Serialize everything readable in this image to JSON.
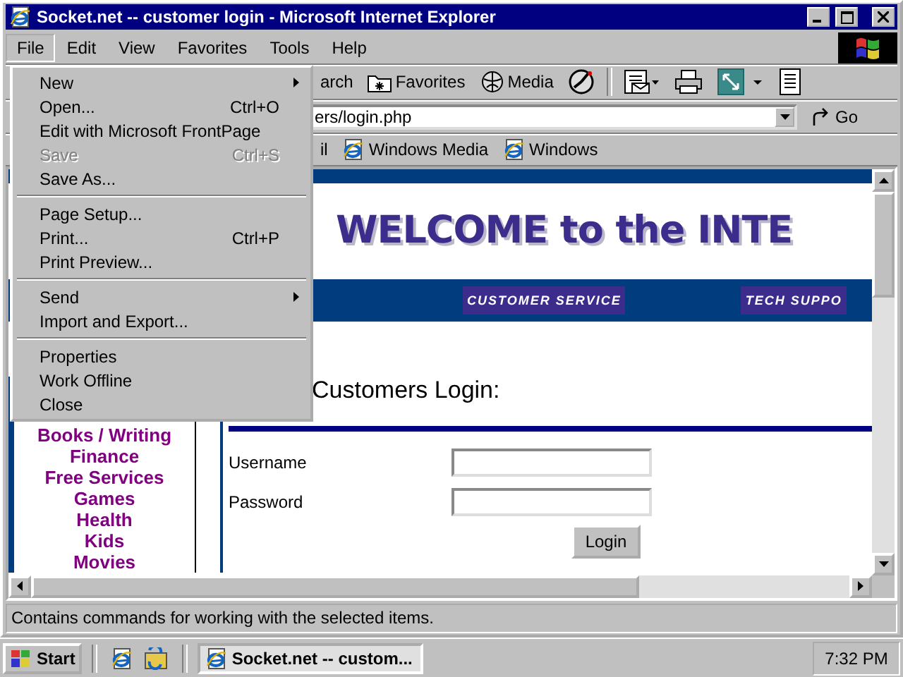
{
  "window": {
    "title": "Socket.net -- customer login - Microsoft Internet Explorer"
  },
  "menu_bar": [
    {
      "label": "File",
      "selected": true
    },
    {
      "label": "Edit",
      "selected": false
    },
    {
      "label": "View",
      "selected": false
    },
    {
      "label": "Favorites",
      "selected": false
    },
    {
      "label": "Tools",
      "selected": false
    },
    {
      "label": "Help",
      "selected": false
    }
  ],
  "file_menu": [
    {
      "kind": "item",
      "label": "New",
      "submenu": true,
      "disabled": false
    },
    {
      "kind": "item",
      "label": "Open...",
      "shortcut": "Ctrl+O",
      "submenu": false,
      "disabled": false
    },
    {
      "kind": "item",
      "label": "Edit with Microsoft FrontPage",
      "submenu": false,
      "disabled": false
    },
    {
      "kind": "item",
      "label": "Save",
      "shortcut": "Ctrl+S",
      "submenu": false,
      "disabled": true
    },
    {
      "kind": "item",
      "label": "Save As...",
      "submenu": false,
      "disabled": false
    },
    {
      "kind": "separator"
    },
    {
      "kind": "item",
      "label": "Page Setup...",
      "submenu": false,
      "disabled": false
    },
    {
      "kind": "item",
      "label": "Print...",
      "shortcut": "Ctrl+P",
      "submenu": false,
      "disabled": false
    },
    {
      "kind": "item",
      "label": "Print Preview...",
      "submenu": false,
      "disabled": false
    },
    {
      "kind": "separator"
    },
    {
      "kind": "item",
      "label": "Send",
      "submenu": true,
      "disabled": false
    },
    {
      "kind": "item",
      "label": "Import and Export...",
      "submenu": false,
      "disabled": false
    },
    {
      "kind": "separator"
    },
    {
      "kind": "item",
      "label": "Properties",
      "submenu": false,
      "disabled": false
    },
    {
      "kind": "item",
      "label": "Work Offline",
      "submenu": false,
      "disabled": false
    },
    {
      "kind": "item",
      "label": "Close",
      "submenu": false,
      "disabled": false
    }
  ],
  "toolbar": [
    {
      "kind": "labeled",
      "label": "arch"
    },
    {
      "kind": "labeled",
      "label": "Favorites"
    },
    {
      "kind": "labeled",
      "label": "Media"
    },
    {
      "kind": "icon"
    },
    {
      "kind": "separator"
    },
    {
      "kind": "icon-dropdown"
    },
    {
      "kind": "icon"
    },
    {
      "kind": "icon-dropdown"
    },
    {
      "kind": "icon"
    }
  ],
  "address_bar": {
    "value": "ers/login.php",
    "go": "Go"
  },
  "links_bar": [
    "il",
    "Windows Media",
    "Windows"
  ],
  "page": {
    "banner": "WELCOME to the INTE",
    "nav_links": [
      "CUSTOMER SERVICE",
      "TECH SUPPO"
    ],
    "heading": "Customers Login:",
    "sidebar_links": [
      "Books / Writing",
      "Finance",
      "Free Services",
      "Games",
      "Health",
      "Kids",
      "Movies"
    ],
    "fields": [
      {
        "label": "Username"
      },
      {
        "label": "Password"
      }
    ],
    "submit": "Login"
  },
  "status_bar": "Contains commands for working with the selected items.",
  "taskbar": {
    "start": "Start",
    "tasks": [
      {
        "label": "Socket.net -- custom...",
        "selected": true
      }
    ],
    "clock": "7:32 PM"
  }
}
